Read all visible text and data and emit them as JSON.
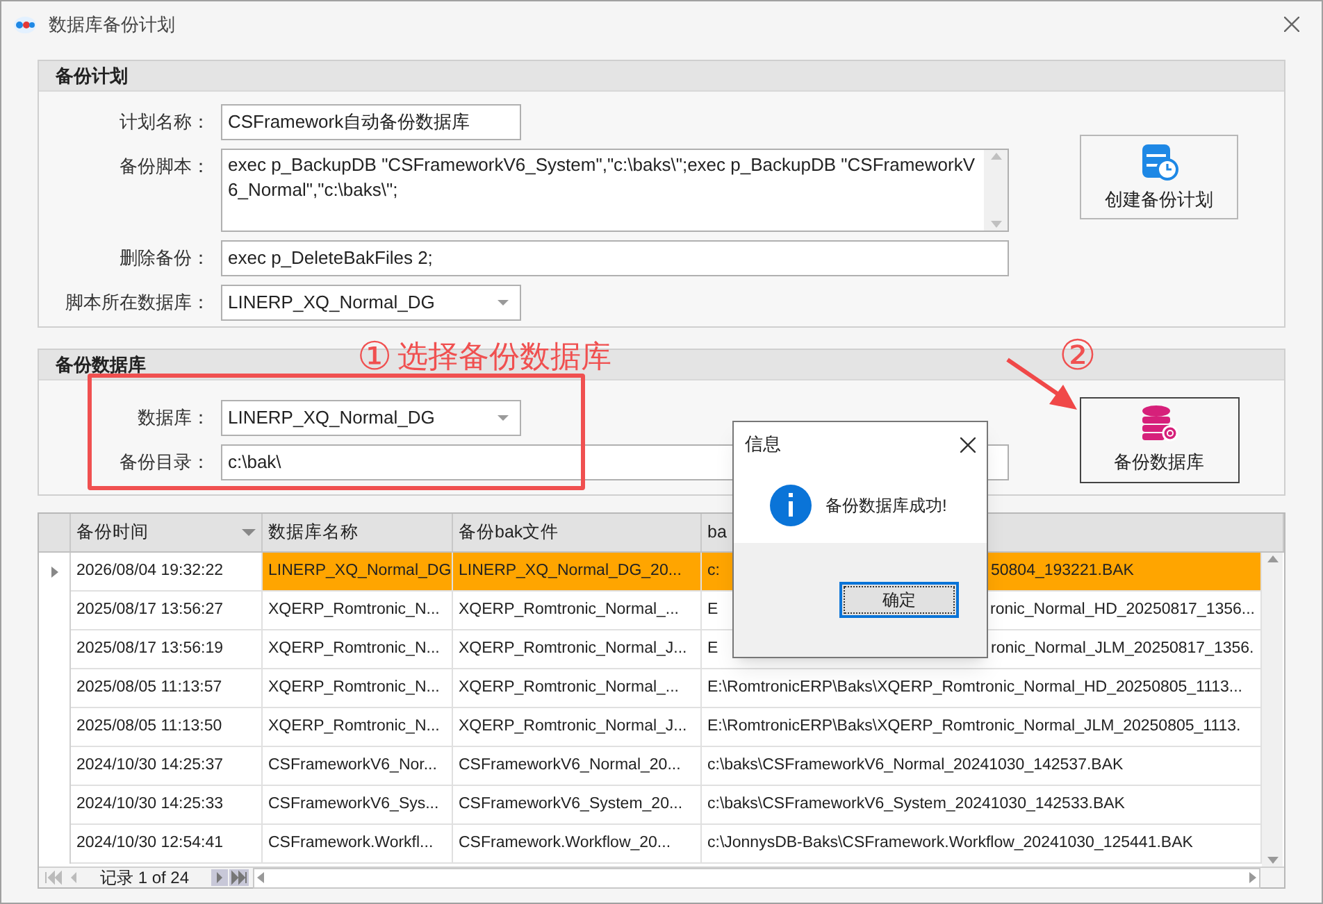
{
  "window": {
    "title": "数据库备份计划"
  },
  "plan_group": {
    "title": "备份计划",
    "button": "创建备份计划",
    "fields": [
      {
        "kind": "text",
        "label": "计划名称：",
        "value": "CSFramework自动备份数据库",
        "wide": false
      },
      {
        "kind": "textarea",
        "label": "备份脚本：",
        "value": "exec p_BackupDB \"CSFrameworkV6_System\",\"c:\\baks\\\";exec p_BackupDB \"CSFrameworkV6_Normal\",\"c:\\baks\\\";",
        "wide": true
      },
      {
        "kind": "text",
        "label": "删除备份：",
        "value": "exec p_DeleteBakFiles 2;",
        "wide": true
      },
      {
        "kind": "combo",
        "label": "脚本所在数据库：",
        "value": "LINERP_XQ_Normal_DG",
        "wide": false
      }
    ]
  },
  "backup_group": {
    "title": "备份数据库",
    "button": "备份数据库",
    "fields": [
      {
        "kind": "combo",
        "label": "数据库：",
        "value": "LINERP_XQ_Normal_DG",
        "wide": false
      },
      {
        "kind": "text",
        "label": "备份目录：",
        "value": "c:\\bak\\",
        "wide": true
      }
    ]
  },
  "annotations": {
    "step1_mark": "①",
    "step1_text": "选择备份数据库",
    "step2_mark": "②"
  },
  "grid": {
    "columns": [
      "备份时间",
      "数据库名称",
      "备份bak文件",
      "ba"
    ],
    "pager": "记录 1 of 24",
    "rows": [
      {
        "selected": true,
        "time": "2026/08/04 19:32:22",
        "db": "LINERP_XQ_Normal_DG",
        "file": "LINERP_XQ_Normal_DG_20...",
        "path_parts": [
          "c:",
          "50804_193221.BAK"
        ]
      },
      {
        "selected": false,
        "time": "2025/08/17 13:56:27",
        "db": "XQERP_Romtronic_N...",
        "file": "XQERP_Romtronic_Normal_...",
        "path_parts": [
          "E",
          "ronic_Normal_HD_20250817_1356..."
        ]
      },
      {
        "selected": false,
        "time": "2025/08/17 13:56:19",
        "db": "XQERP_Romtronic_N...",
        "file": "XQERP_Romtronic_Normal_J...",
        "path_parts": [
          "E",
          "ronic_Normal_JLM_20250817_1356."
        ]
      },
      {
        "selected": false,
        "time": "2025/08/05 11:13:57",
        "db": "XQERP_Romtronic_N...",
        "file": "XQERP_Romtronic_Normal_...",
        "path": "E:\\RomtronicERP\\Baks\\XQERP_Romtronic_Normal_HD_20250805_1113..."
      },
      {
        "selected": false,
        "time": "2025/08/05 11:13:50",
        "db": "XQERP_Romtronic_N...",
        "file": "XQERP_Romtronic_Normal_J...",
        "path": "E:\\RomtronicERP\\Baks\\XQERP_Romtronic_Normal_JLM_20250805_1113."
      },
      {
        "selected": false,
        "time": "2024/10/30 14:25:37",
        "db": "CSFrameworkV6_Nor...",
        "file": "CSFrameworkV6_Normal_20...",
        "path": "c:\\baks\\CSFrameworkV6_Normal_20241030_142537.BAK"
      },
      {
        "selected": false,
        "time": "2024/10/30 14:25:33",
        "db": "CSFrameworkV6_Sys...",
        "file": "CSFrameworkV6_System_20...",
        "path": "c:\\baks\\CSFrameworkV6_System_20241030_142533.BAK"
      },
      {
        "selected": false,
        "time": "2024/10/30 12:54:41",
        "db": "CSFramework.Workfl...",
        "file": "CSFramework.Workflow_20...",
        "path": "c:\\JonnysDB-Baks\\CSFramework.Workflow_20241030_125441.BAK"
      }
    ]
  },
  "dialog": {
    "title": "信息",
    "message": "备份数据库成功!",
    "button": "确定"
  }
}
